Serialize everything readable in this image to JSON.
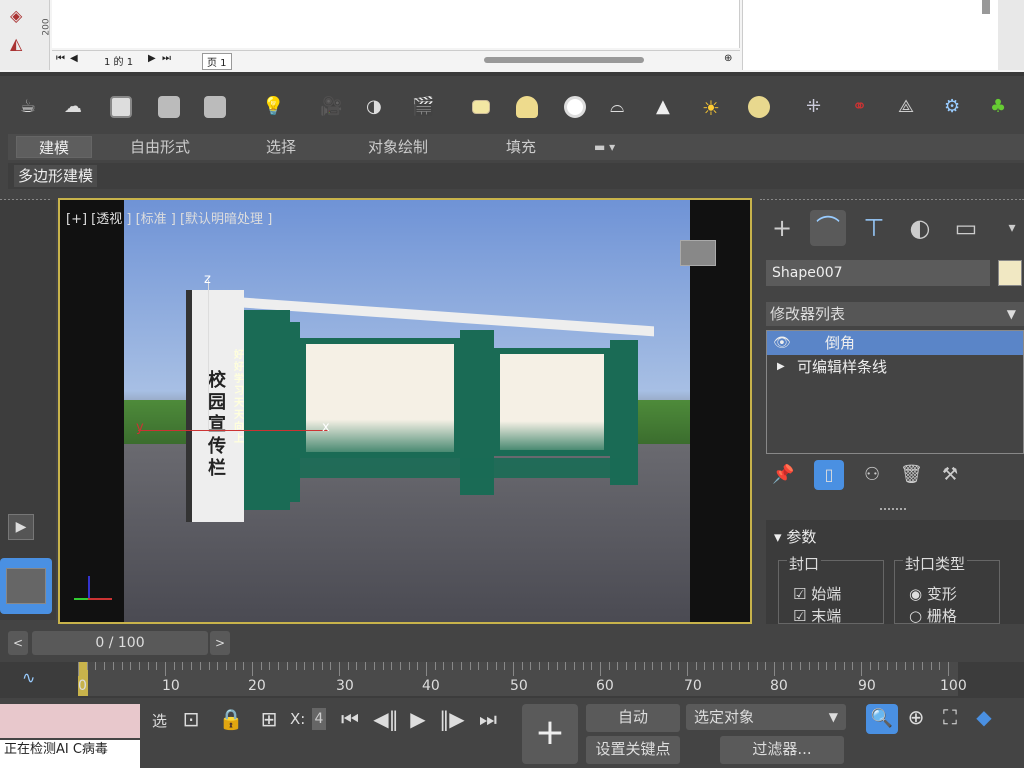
{
  "doc": {
    "ruler_num": "200",
    "page_counter": "1 的 1",
    "page_tab": "页 1"
  },
  "ribbon": {
    "tabs": [
      "建模",
      "自由形式",
      "选择",
      "对象绘制",
      "填充"
    ],
    "sub_label": "多边形建模"
  },
  "viewport": {
    "label": "[+] [透视 ] [标准 ] [默认明暗处理 ]",
    "axis_x": "x",
    "axis_y": "y",
    "axis_z": "z",
    "scene": {
      "slogan_left": "好好学习 天天向上",
      "title": "校园宣传栏"
    }
  },
  "command_panel": {
    "object_name": "Shape007",
    "object_color": "#f1e8c3",
    "modifier_list": "修改器列表",
    "stack": [
      {
        "label": "倒角",
        "selected": true
      },
      {
        "label": "可编辑样条线",
        "selected": false
      }
    ],
    "params": {
      "header": "参数",
      "cap_group": "封口",
      "cap_type_group": "封口类型",
      "cap_start": "始端",
      "cap_end": "末端",
      "cap_type_morph": "变形",
      "cap_type_grid": "栅格"
    }
  },
  "timeline": {
    "frame_display": "0 / 100",
    "ticks": [
      "0",
      "10",
      "20",
      "30",
      "40",
      "50",
      "60",
      "70",
      "80",
      "90",
      "100"
    ]
  },
  "status": {
    "select_label": "选",
    "x_label": "X:",
    "x_value": "4",
    "auto_button": "自动",
    "set_key_button": "设置关键点",
    "selection_dropdown": "选定对象",
    "filter_button": "过滤器...",
    "status_text": "正在检测AI C病毒"
  },
  "colors": {
    "viewport_border": "#c8b34b",
    "selected_row": "#5a85c8",
    "accent_blue": "#4a90e2"
  }
}
